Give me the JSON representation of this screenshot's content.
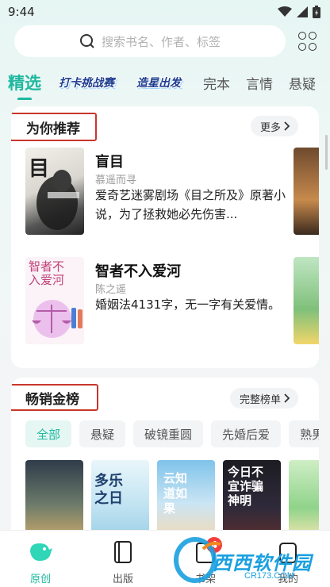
{
  "status": {
    "time": "9:44"
  },
  "search": {
    "placeholder": "搜索书名、作者、标签"
  },
  "tabs": [
    {
      "label": "精选",
      "active": true
    },
    {
      "label": "打卡挑战赛"
    },
    {
      "label": "造星出发"
    },
    {
      "label": "完本"
    },
    {
      "label": "言情"
    },
    {
      "label": "悬疑"
    }
  ],
  "recommend": {
    "title": "为你推荐",
    "more": "更多",
    "books": [
      {
        "title": "盲目",
        "author": "慕遥而寻",
        "desc": "爱奇艺迷雾剧场《目之所及》原著小说，为了拯救她必先伤害...",
        "cover_text": "目"
      },
      {
        "title": "智者不入爱河",
        "author": "陈之遥",
        "desc": "婚姻法4131字，无一字有关爱情。",
        "cover_text": "智者不入爱河"
      }
    ]
  },
  "ranking": {
    "title": "畅销金榜",
    "more": "完整榜单",
    "filters": [
      "全部",
      "悬疑",
      "破镜重圆",
      "先婚后爱",
      "熟男"
    ],
    "covers": [
      {
        "text": ""
      },
      {
        "text": "多乐之日"
      },
      {
        "text": "云知道如果"
      },
      {
        "text": "今日不宜诈骗神明"
      },
      {
        "text": ""
      }
    ]
  },
  "bottom_nav": [
    {
      "label": "原创",
      "icon": "bird-icon",
      "active": true
    },
    {
      "label": "出版",
      "icon": "book-icon"
    },
    {
      "label": "书架",
      "icon": "bookshelf-icon",
      "badge": "4"
    },
    {
      "label": "我的",
      "icon": "profile-icon"
    }
  ],
  "watermark": {
    "brand": "西西软件园",
    "url": "CR173.COM"
  },
  "colors": {
    "accent": "#1fb89f",
    "highlight_border": "#c9372c",
    "badge": "#f23e3e"
  }
}
